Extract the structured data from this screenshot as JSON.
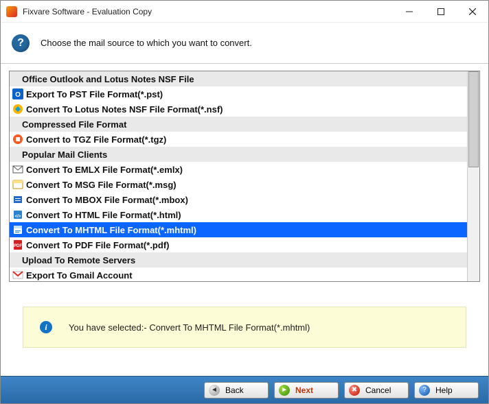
{
  "window": {
    "title": "Fixvare Software - Evaluation Copy"
  },
  "header": {
    "prompt": "Choose the mail source to which you want to convert."
  },
  "list": {
    "group1": {
      "label": "Office Outlook and Lotus Notes NSF File"
    },
    "pst": {
      "label": "Export To PST File Format(*.pst)"
    },
    "nsf": {
      "label": "Convert To Lotus Notes NSF File Format(*.nsf)"
    },
    "group2": {
      "label": "Compressed File Format"
    },
    "tgz": {
      "label": "Convert to TGZ File Format(*.tgz)"
    },
    "group3": {
      "label": "Popular Mail Clients"
    },
    "emlx": {
      "label": "Convert To EMLX File Format(*.emlx)"
    },
    "msg": {
      "label": "Convert To MSG File Format(*.msg)"
    },
    "mbox": {
      "label": "Convert To MBOX File Format(*.mbox)"
    },
    "html": {
      "label": "Convert To HTML File Format(*.html)"
    },
    "mhtml": {
      "label": "Convert To MHTML File Format(*.mhtml)"
    },
    "pdf": {
      "label": "Convert To PDF File Format(*.pdf)"
    },
    "group4": {
      "label": "Upload To Remote Servers"
    },
    "gmail": {
      "label": "Export To Gmail Account"
    }
  },
  "status": {
    "text": "You have selected:- Convert To MHTML File Format(*.mhtml)"
  },
  "buttons": {
    "back": "Back",
    "next": "Next",
    "cancel": "Cancel",
    "help": "Help"
  },
  "selected": "mhtml"
}
